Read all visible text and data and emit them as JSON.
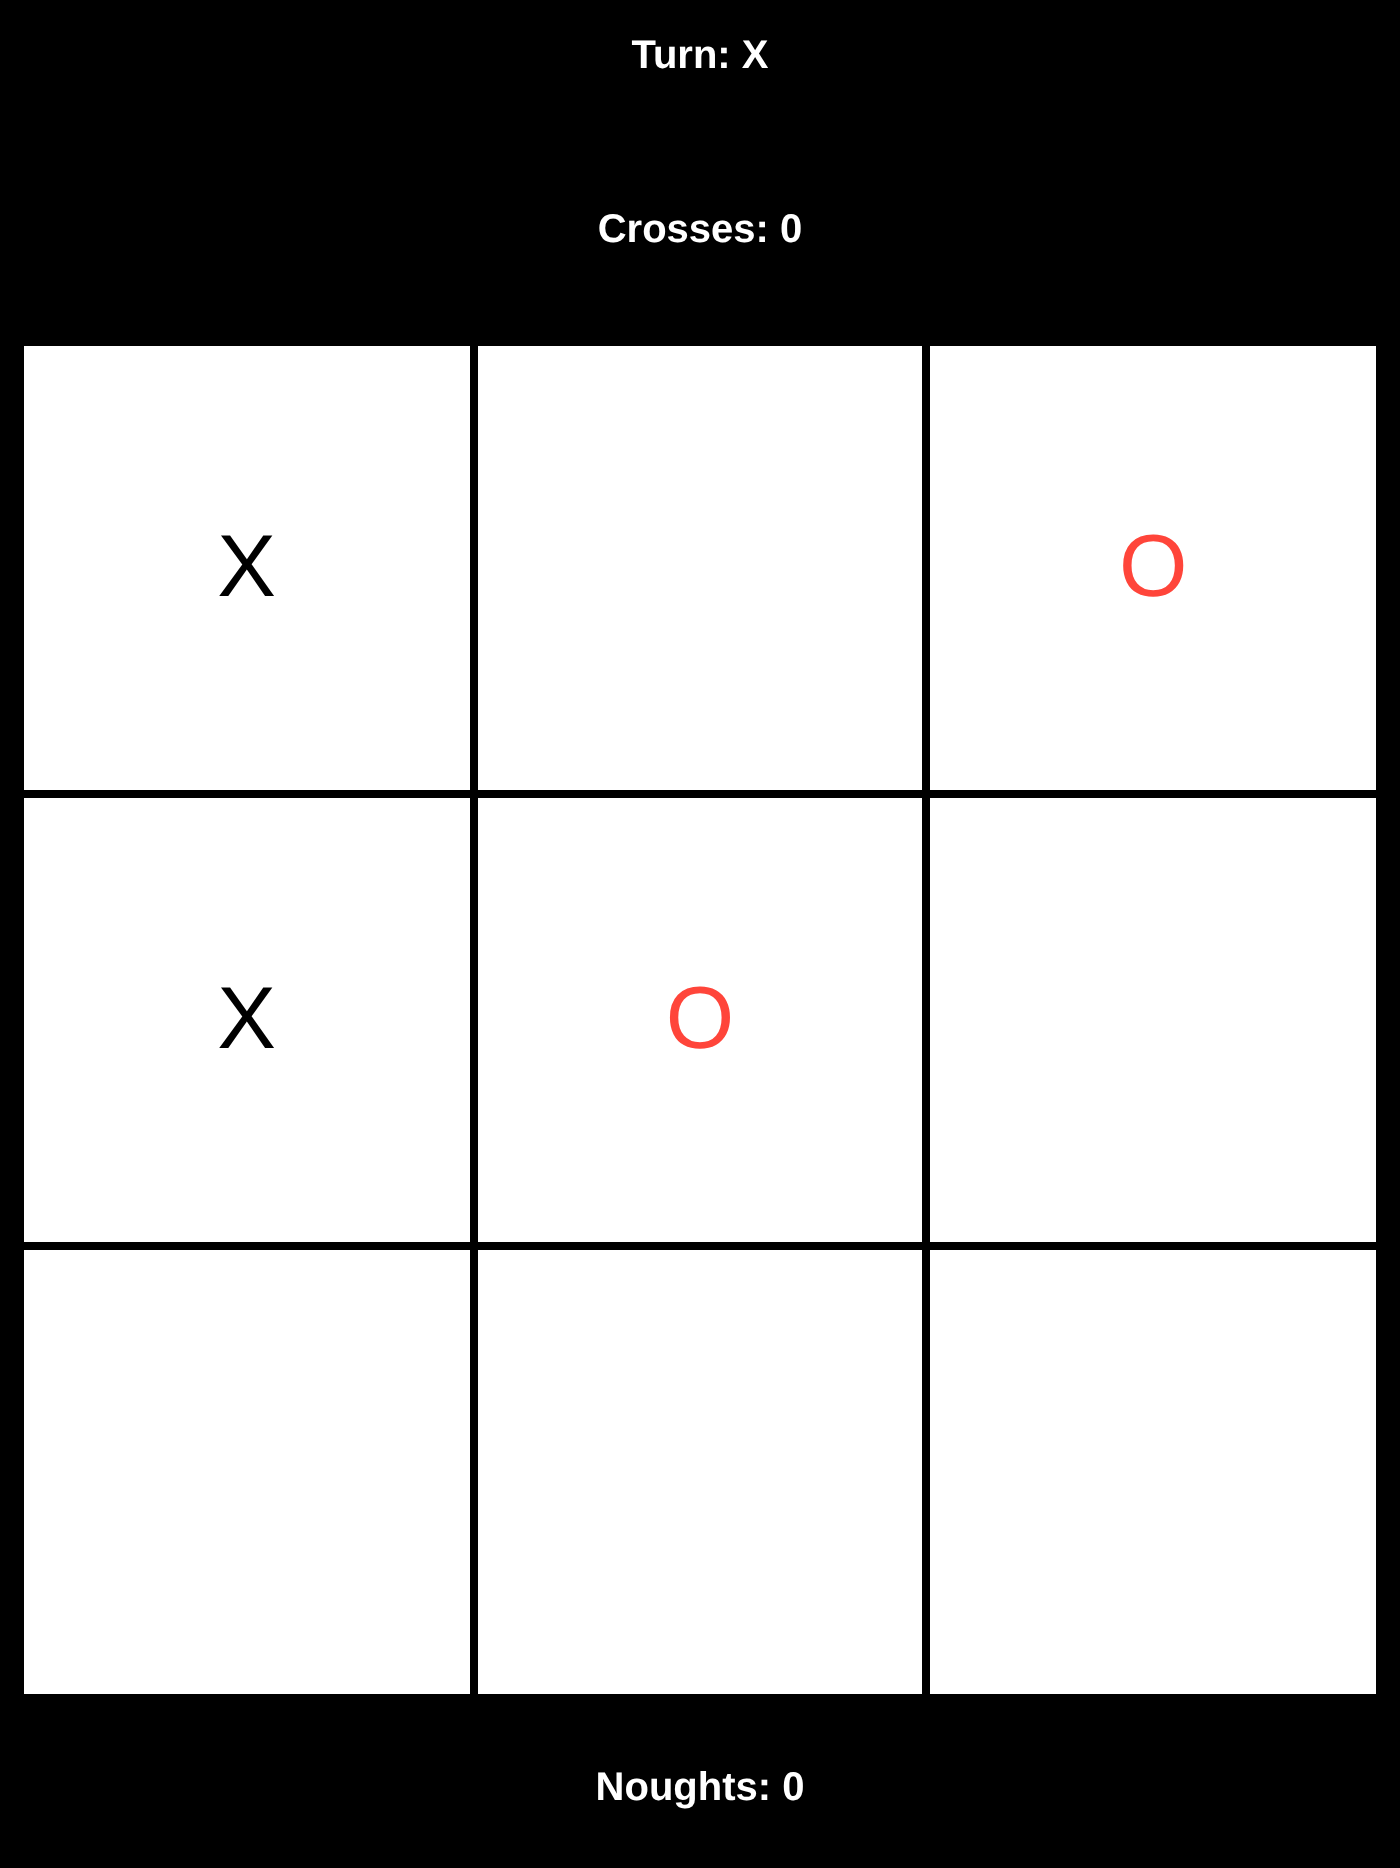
{
  "turn_label": "Turn: X",
  "crosses_score": "Crosses: 0",
  "board": [
    {
      "kind": "cross",
      "mark": "X"
    },
    {
      "kind": "empty"
    },
    {
      "kind": "nought",
      "mark": "O"
    },
    {
      "kind": "cross",
      "mark": "X"
    },
    {
      "kind": "nought",
      "mark": "O"
    },
    {
      "kind": "empty"
    },
    {
      "kind": "empty"
    },
    {
      "kind": "empty"
    },
    {
      "kind": "empty"
    }
  ],
  "noughts_score": "Noughts: 0"
}
